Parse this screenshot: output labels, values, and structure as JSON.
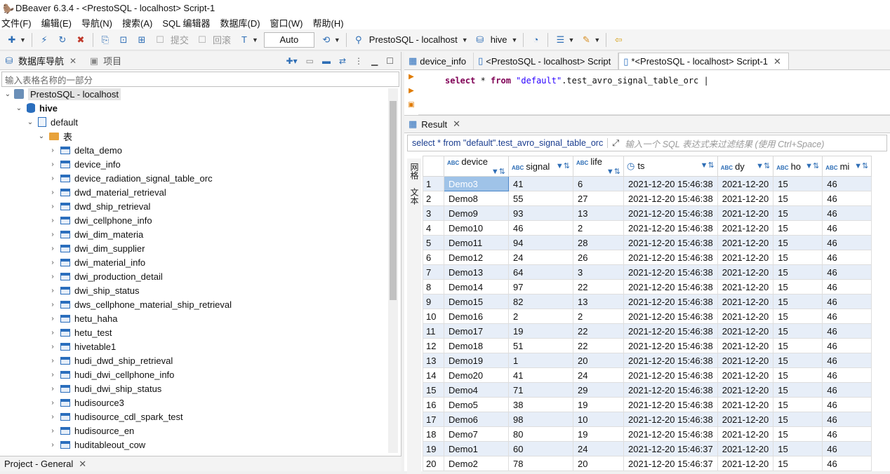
{
  "window": {
    "title": "DBeaver 6.3.4 - <PrestoSQL - localhost> Script-1"
  },
  "menu": [
    "文件(F)",
    "编辑(E)",
    "导航(N)",
    "搜索(A)",
    "SQL 编辑器",
    "数据库(D)",
    "窗口(W)",
    "帮助(H)"
  ],
  "toolbar": {
    "commit_label": "提交",
    "rollback_label": "回滚",
    "mode_value": "Auto",
    "connection_label": "PrestoSQL - localhost",
    "database_label": "hive"
  },
  "left_panel": {
    "tab_navigator": "数据库导航",
    "tab_projects": "项目",
    "filter_placeholder": "输入表格名称的一部分",
    "connection": "PrestoSQL - localhost",
    "database": "hive",
    "schema": "default",
    "folder": "表",
    "tables": [
      "delta_demo",
      "device_info",
      "device_radiation_signal_table_orc",
      "dwd_material_retrieval",
      "dwd_ship_retrieval",
      "dwi_cellphone_info",
      "dwi_dim_materia",
      "dwi_dim_supplier",
      "dwi_material_info",
      "dwi_production_detail",
      "dwi_ship_status",
      "dws_cellphone_material_ship_retrieval",
      "hetu_haha",
      "hetu_test",
      "hivetable1",
      "hudi_dwd_ship_retrieval",
      "hudi_dwi_cellphone_info",
      "hudi_dwi_ship_status",
      "hudisource3",
      "hudisource_cdl_spark_test",
      "hudisource_en",
      "huditableout_cow"
    ],
    "bottom_tab": "Project - General"
  },
  "editor": {
    "tabs": [
      "device_info",
      "<PrestoSQL - localhost> Script",
      "*<PrestoSQL - localhost> Script-1"
    ],
    "sql_keyword1": "select",
    "sql_mid": " * ",
    "sql_keyword2": "from",
    "sql_string": " \"default\"",
    "sql_tail": ".test_avro_signal_table_orc "
  },
  "result": {
    "tab_label": "Result",
    "query_text": "select * from \"default\".test_avro_signal_table_orc",
    "filter_hint": "输入一个 SQL 表达式来过滤结果 (使用 Ctrl+Space)",
    "side_tab_grid": "网格",
    "side_tab_text": "文本",
    "columns": [
      "device",
      "signal",
      "life",
      "ts",
      "dy",
      "ho",
      "mi"
    ],
    "rows": [
      [
        "1",
        "Demo3",
        "41",
        "6",
        "2021-12-20 15:46:38",
        "2021-12-20",
        "15",
        "46"
      ],
      [
        "2",
        "Demo8",
        "55",
        "27",
        "2021-12-20 15:46:38",
        "2021-12-20",
        "15",
        "46"
      ],
      [
        "3",
        "Demo9",
        "93",
        "13",
        "2021-12-20 15:46:38",
        "2021-12-20",
        "15",
        "46"
      ],
      [
        "4",
        "Demo10",
        "46",
        "2",
        "2021-12-20 15:46:38",
        "2021-12-20",
        "15",
        "46"
      ],
      [
        "5",
        "Demo11",
        "94",
        "28",
        "2021-12-20 15:46:38",
        "2021-12-20",
        "15",
        "46"
      ],
      [
        "6",
        "Demo12",
        "24",
        "26",
        "2021-12-20 15:46:38",
        "2021-12-20",
        "15",
        "46"
      ],
      [
        "7",
        "Demo13",
        "64",
        "3",
        "2021-12-20 15:46:38",
        "2021-12-20",
        "15",
        "46"
      ],
      [
        "8",
        "Demo14",
        "97",
        "22",
        "2021-12-20 15:46:38",
        "2021-12-20",
        "15",
        "46"
      ],
      [
        "9",
        "Demo15",
        "82",
        "13",
        "2021-12-20 15:46:38",
        "2021-12-20",
        "15",
        "46"
      ],
      [
        "10",
        "Demo16",
        "2",
        "2",
        "2021-12-20 15:46:38",
        "2021-12-20",
        "15",
        "46"
      ],
      [
        "11",
        "Demo17",
        "19",
        "22",
        "2021-12-20 15:46:38",
        "2021-12-20",
        "15",
        "46"
      ],
      [
        "12",
        "Demo18",
        "51",
        "22",
        "2021-12-20 15:46:38",
        "2021-12-20",
        "15",
        "46"
      ],
      [
        "13",
        "Demo19",
        "1",
        "20",
        "2021-12-20 15:46:38",
        "2021-12-20",
        "15",
        "46"
      ],
      [
        "14",
        "Demo20",
        "41",
        "24",
        "2021-12-20 15:46:38",
        "2021-12-20",
        "15",
        "46"
      ],
      [
        "15",
        "Demo4",
        "71",
        "29",
        "2021-12-20 15:46:38",
        "2021-12-20",
        "15",
        "46"
      ],
      [
        "16",
        "Demo5",
        "38",
        "19",
        "2021-12-20 15:46:38",
        "2021-12-20",
        "15",
        "46"
      ],
      [
        "17",
        "Demo6",
        "98",
        "10",
        "2021-12-20 15:46:38",
        "2021-12-20",
        "15",
        "46"
      ],
      [
        "18",
        "Demo7",
        "80",
        "19",
        "2021-12-20 15:46:38",
        "2021-12-20",
        "15",
        "46"
      ],
      [
        "19",
        "Demo1",
        "60",
        "24",
        "2021-12-20 15:46:37",
        "2021-12-20",
        "15",
        "46"
      ],
      [
        "20",
        "Demo2",
        "78",
        "20",
        "2021-12-20 15:46:37",
        "2021-12-20",
        "15",
        "46"
      ]
    ]
  }
}
